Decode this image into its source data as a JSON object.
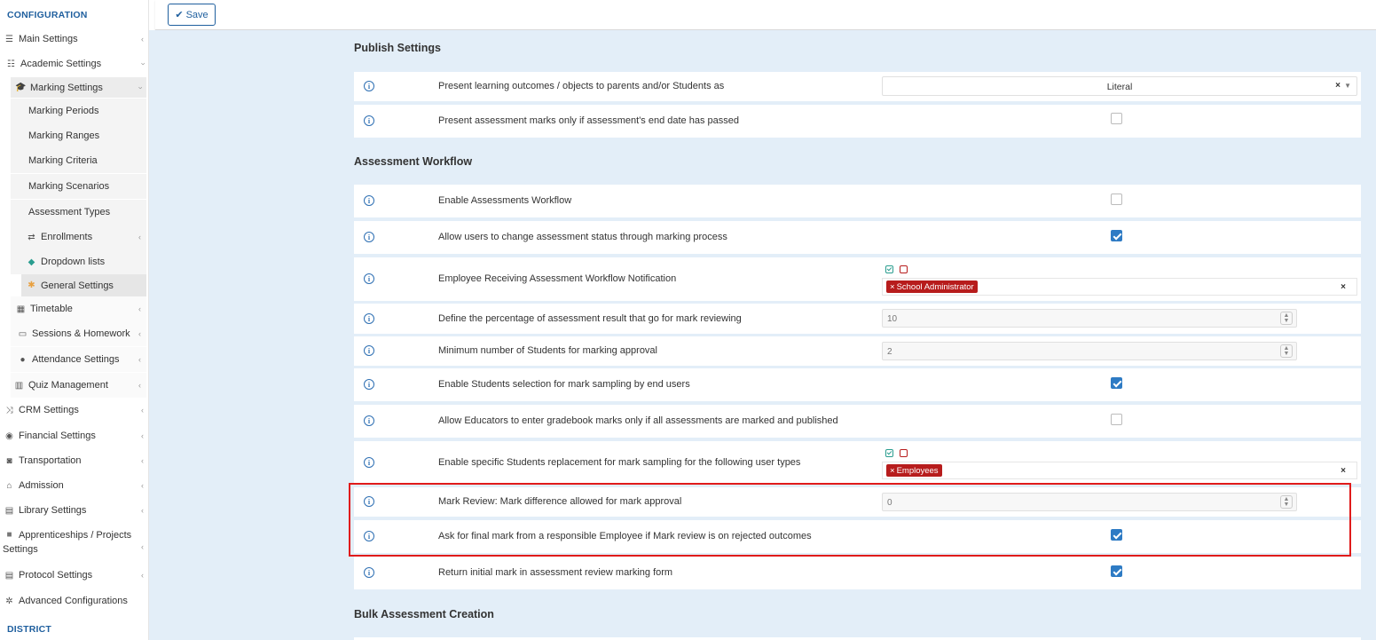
{
  "sidebar": {
    "configuration_title": "CONFIGURATION",
    "district_title": "DISTRICT",
    "items": [
      {
        "label": "Main Settings",
        "icon": "sliders-icon"
      },
      {
        "label": "Academic Settings",
        "icon": "sitemap-icon"
      },
      {
        "label": "Marking Settings",
        "icon": "graduation-cap-icon"
      },
      {
        "label": "Marking Periods"
      },
      {
        "label": "Marking Ranges"
      },
      {
        "label": "Marking Criteria"
      },
      {
        "label": "Marking Scenarios"
      },
      {
        "label": "Assessment Types"
      },
      {
        "label": "Enrollments",
        "icon": "exchange-icon"
      },
      {
        "label": "Dropdown lists",
        "icon": "layers-icon"
      },
      {
        "label": "General Settings",
        "icon": "gear-icon"
      },
      {
        "label": "Timetable",
        "icon": "calendar-icon"
      },
      {
        "label": "Sessions & Homework",
        "icon": "chalkboard-icon"
      },
      {
        "label": "Attendance Settings",
        "icon": "user-check-icon"
      },
      {
        "label": "Quiz Management",
        "icon": "quiz-icon"
      },
      {
        "label": "CRM Settings",
        "icon": "shuffle-icon"
      },
      {
        "label": "Financial Settings",
        "icon": "coins-icon"
      },
      {
        "label": "Transportation",
        "icon": "bus-icon"
      },
      {
        "label": "Admission",
        "icon": "institution-icon"
      },
      {
        "label": "Library Settings",
        "icon": "books-icon"
      },
      {
        "label": "Apprenticeships / Projects",
        "label2": "Settings",
        "icon": "cube-icon"
      },
      {
        "label": "Protocol Settings",
        "icon": "protocol-icon"
      },
      {
        "label": "Advanced Configurations",
        "icon": "cogs-icon"
      }
    ]
  },
  "toolbar": {
    "save_label": "Save"
  },
  "sections": {
    "publish": "Publish Settings",
    "workflow": "Assessment Workflow",
    "bulk": "Bulk Assessment Creation"
  },
  "rows": {
    "r1": {
      "label": "Present learning outcomes / objects to parents and/or Students as",
      "value": "Literal"
    },
    "r2": {
      "label": "Present assessment marks only if assessment's end date has passed",
      "checked": false
    },
    "r3": {
      "label": "Enable Assessments Workflow",
      "checked": false
    },
    "r4": {
      "label": "Allow users to change assessment status through marking process",
      "checked": true
    },
    "r5": {
      "label": "Employee Receiving Assessment Workflow Notification",
      "tag": "School Administrator"
    },
    "r6": {
      "label": "Define the percentage of assessment result that go for mark reviewing",
      "value": "10"
    },
    "r7": {
      "label": "Minimum number of Students for marking approval",
      "value": "2"
    },
    "r8": {
      "label": "Enable Students selection for mark sampling by end users",
      "checked": true
    },
    "r9": {
      "label": "Allow Educators to enter gradebook marks only if all assessments are marked and published",
      "checked": false
    },
    "r10": {
      "label": "Enable specific Students replacement for mark sampling for the following user types",
      "tag": "Employees"
    },
    "r11": {
      "label": "Mark Review: Mark difference allowed for mark approval",
      "value": "0"
    },
    "r12": {
      "label": "Ask for final mark from a responsible Employee if Mark review is on rejected outcomes",
      "checked": true
    },
    "r13": {
      "label": "Return initial mark in assessment review marking form",
      "checked": true
    }
  },
  "glyphs": {
    "info": "i",
    "clear": "×",
    "caret": "▼",
    "tag_x": "×",
    "spin_up": "▲",
    "spin_down": "▼",
    "chevron": "‹",
    "check": "✔"
  },
  "colors": {
    "accent": "#1f5f9e",
    "tag_bg": "#b71c1c",
    "highlight": "#e01b1b",
    "checkbox": "#2e7bc4"
  }
}
